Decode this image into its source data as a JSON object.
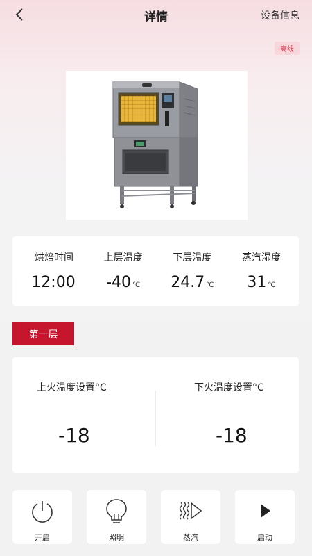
{
  "header": {
    "title": "详情",
    "right_link": "设备信息"
  },
  "status": {
    "badge": "离线",
    "color": "#d23a4e"
  },
  "stats": [
    {
      "label": "烘焙时间",
      "value": "12:00",
      "unit": ""
    },
    {
      "label": "上层温度",
      "value": "-40",
      "unit": "℃"
    },
    {
      "label": "下层温度",
      "value": "24.7",
      "unit": "℃"
    },
    {
      "label": "蒸汽湿度",
      "value": "31",
      "unit": "℃"
    }
  ],
  "layer": {
    "label": "第一层",
    "color": "#c5162e"
  },
  "settings": {
    "top_fire_label": "上火温度设置°C",
    "top_fire_value": "-18",
    "bottom_fire_label": "下火温度设置°C",
    "bottom_fire_value": "-18"
  },
  "controls": [
    {
      "label": "开启",
      "icon": "power-icon"
    },
    {
      "label": "照明",
      "icon": "lightbulb-icon"
    },
    {
      "label": "蒸汽",
      "icon": "steam-icon"
    },
    {
      "label": "启动",
      "icon": "play-icon"
    }
  ]
}
